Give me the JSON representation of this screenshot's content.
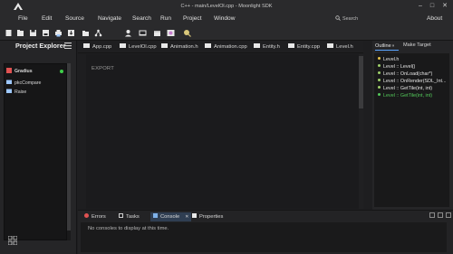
{
  "window": {
    "title": "C++ - main/LevelOl.cpp - Moonlight SDK",
    "controls": [
      "–",
      "□",
      "✕"
    ]
  },
  "menu": {
    "items": [
      "File",
      "Edit",
      "Source",
      "Navigate",
      "Search",
      "Run",
      "Project",
      "Window"
    ],
    "about": "About",
    "search_placeholder": "Search"
  },
  "explorer": {
    "title": "Project Explorer",
    "items": [
      {
        "label": "Gradius",
        "status_color": "#3ecf4a"
      },
      {
        "label": "pkcCompare"
      },
      {
        "label": "Raise"
      }
    ]
  },
  "editor": {
    "tabs": [
      "App.cpp",
      "LevelOl.cpp",
      "Animation.h",
      "Animation.cpp",
      "Entity.h",
      "Entity.cpp",
      "Level.h"
    ],
    "content": "EXPORT"
  },
  "outline": {
    "tabs": [
      "Outline",
      "Make Target"
    ],
    "items": [
      {
        "label": "Level.h",
        "color": "#e6e6e6",
        "dot": "#e6c34a"
      },
      {
        "label": "Level :: Level()",
        "color": "#e6e6e6",
        "dot": "#9fd16b"
      },
      {
        "label": "Level :: OnLoad(char*)",
        "color": "#e6e6e6",
        "dot": "#9fd16b"
      },
      {
        "label": "Level :: OnRender(SDL_Int...",
        "color": "#e6e6e6",
        "dot": "#9fd16b"
      },
      {
        "label": "Level :: GetTile(int, int)",
        "color": "#e6e6e6",
        "dot": "#9fd16b"
      },
      {
        "label": "Level :: GetTile(int, int)",
        "color": "#53c95a",
        "dot": "#53c95a"
      }
    ]
  },
  "bottom": {
    "tabs": [
      "Errors",
      "Tasks",
      "Console",
      "Properties"
    ],
    "console_close": "✕",
    "message": "No consoles to display at this time."
  },
  "colors": {
    "accent": "#5aa5ff",
    "console_tab_bg": "#2f3e52",
    "error_red": "#e05252"
  }
}
